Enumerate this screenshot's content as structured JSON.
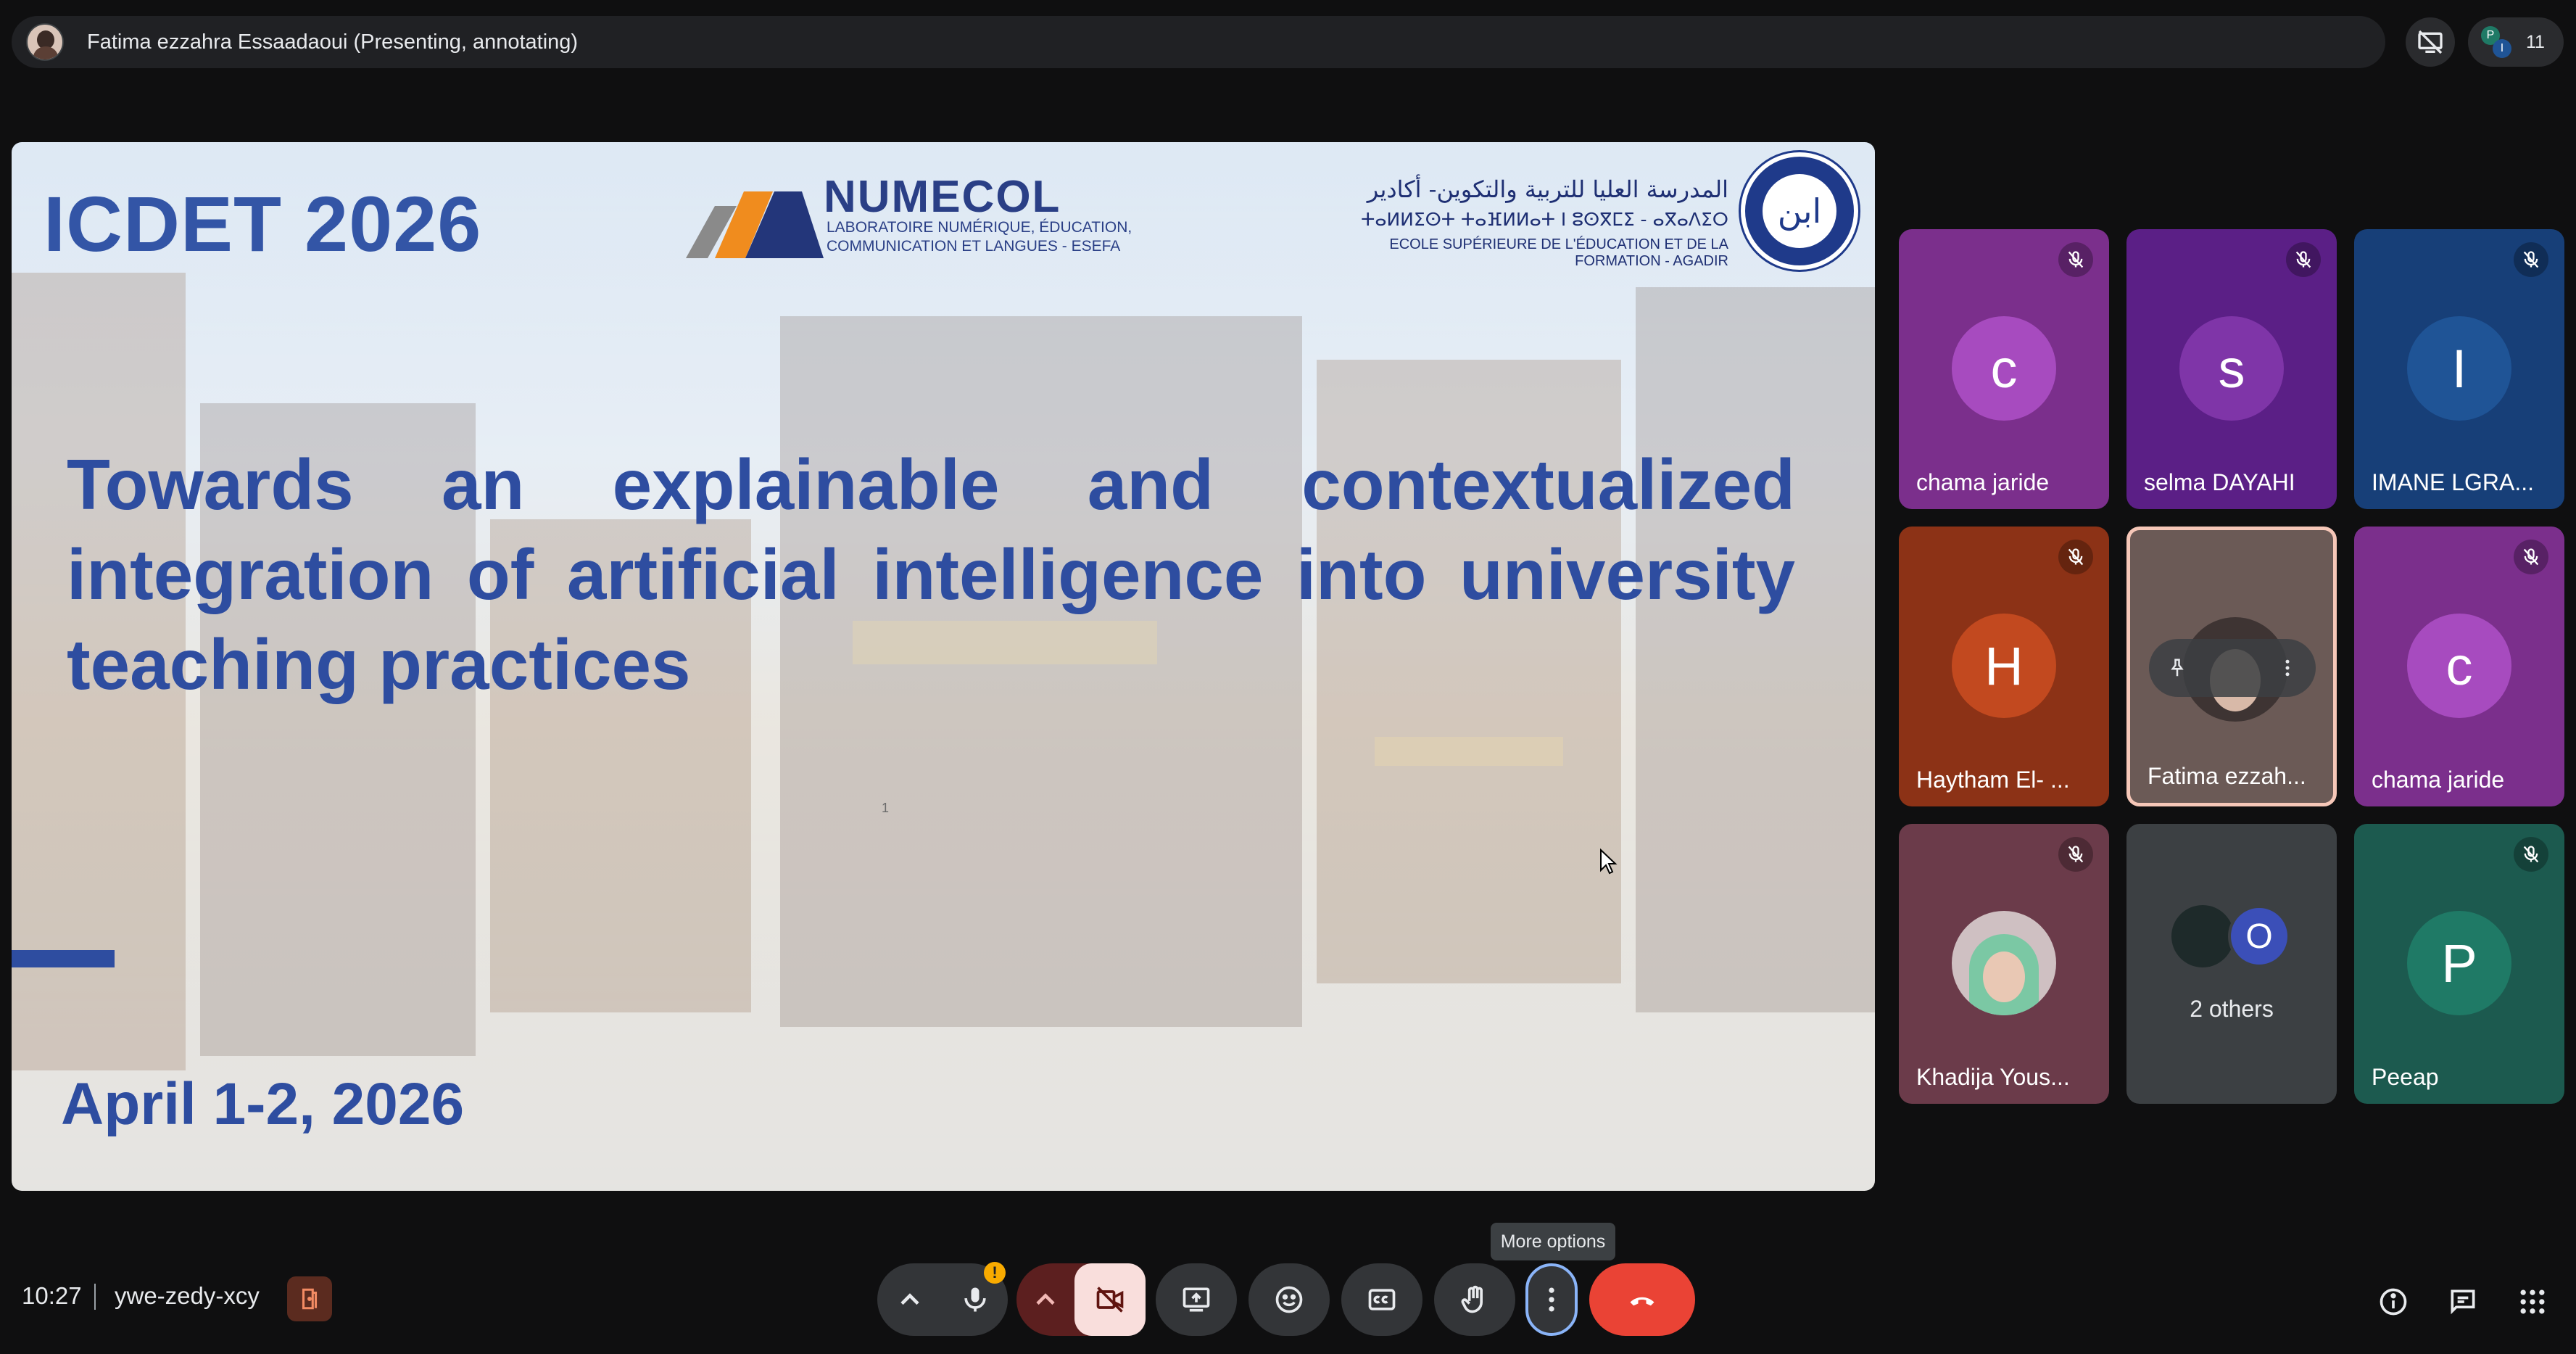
{
  "top_bar": {
    "presenter_label": "Fatima ezzahra Essaadaoui (Presenting, annotating)",
    "participant_count": "11",
    "mini_avatars": [
      "P",
      "I"
    ]
  },
  "slide": {
    "conference_title": "ICDET 2026",
    "lab_name": "NUMECOL",
    "lab_subtitle_line1": "LABORATOIRE NUMÉRIQUE, ÉDUCATION,",
    "lab_subtitle_line2": "COMMUNICATION ET LANGUES - ESEFA",
    "school_arabic": "المدرسة العليا للتربية والتكوين- أكادير",
    "school_tifinagh": "ⵜⴰⵍⵍⵉⵙⵜ ⵜⴰⴼⵍⵍⴰⵜ ⵏ ⵓⵙⴳⵎⵉ - ⴰⴳⴰⴷⵉⵔ",
    "school_french": "ECOLE SUPÉRIEURE DE L'ÉDUCATION ET DE LA FORMATION - AGADIR",
    "seal_glyph": "ﺍﺑﻦ",
    "heading": "Towards an explainable and contextualized integration of artificial intelligence into university teaching practices",
    "date": "April 1-2, 2026",
    "page_number": "1"
  },
  "participants": [
    {
      "name": "chama jaride",
      "initial": "c",
      "bg": "#7b2f8c",
      "avatar": "#a74bbf",
      "muted": true
    },
    {
      "name": "selma DAYAHI",
      "initial": "s",
      "bg": "#5b1f86",
      "avatar": "#7f35a8",
      "muted": true
    },
    {
      "name": "IMANE LGRA...",
      "initial": "I",
      "bg": "#173f78",
      "avatar": "#1f5496",
      "muted": true
    },
    {
      "name": "Haytham El- ...",
      "initial": "H",
      "bg": "#8c3216",
      "avatar": "#c2491f",
      "muted": true
    },
    {
      "name": "Fatima ezzah...",
      "initial": "",
      "bg": "#6b5a56",
      "avatar": "#3e3433",
      "muted": false
    },
    {
      "name": "chama jaride",
      "initial": "c",
      "bg": "#7b2f8c",
      "avatar": "#a74bbf",
      "muted": true
    },
    {
      "name": "Khadija Yous...",
      "initial": "",
      "bg": "#6b3b4a",
      "avatar": "#cfc0c2",
      "muted": true
    },
    {
      "name": "2 others",
      "initial": "O",
      "bg": "#3c4043",
      "avatar": "#3b4fb8",
      "muted": false
    },
    {
      "name": "Peeap",
      "initial": "P",
      "bg": "#1c5a4f",
      "avatar": "#1f7a66",
      "muted": true
    }
  ],
  "bottom_bar": {
    "time": "10:27",
    "meeting_code": "ywe-zedy-xcy",
    "tooltip": "More options",
    "mic_warning": "!"
  },
  "colors": {
    "accent_slide": "#2e4da0",
    "end_call": "#ea4335",
    "camera_off_bg": "#f9dedc",
    "focus_ring": "#8ab4f8"
  },
  "icons": [
    "participant-avatar-icon",
    "screen-share-off-icon",
    "mic-off-icon",
    "pin-icon",
    "more-vert-icon",
    "chevron-up-icon",
    "mic-icon",
    "videocam-off-icon",
    "present-screen-icon",
    "emoji-icon",
    "captions-icon",
    "raise-hand-icon",
    "call-end-icon",
    "info-icon",
    "chat-icon",
    "apps-icon",
    "host-controls-icon"
  ]
}
